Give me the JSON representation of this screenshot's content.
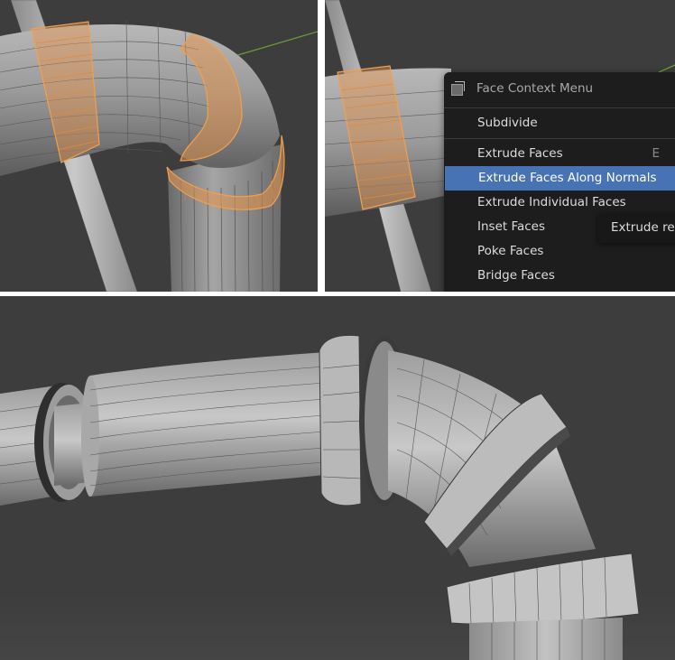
{
  "context_menu": {
    "title": "Face Context Menu",
    "icon": "face-select-icon",
    "items": [
      {
        "label": "Subdivide",
        "shortcut": ""
      },
      {
        "label": "Extrude Faces",
        "shortcut": "E"
      },
      {
        "label": "Extrude Faces Along Normals",
        "shortcut": "",
        "highlighted": true
      },
      {
        "label": "Extrude Individual Faces",
        "shortcut": ""
      },
      {
        "label": "Inset Faces",
        "shortcut": ""
      },
      {
        "label": "Poke Faces",
        "shortcut": ""
      },
      {
        "label": "Bridge Faces",
        "shortcut": ""
      }
    ]
  },
  "tooltip": {
    "text": "Extrude reg"
  },
  "colors": {
    "viewport_bg": "#3d3d3d",
    "selection_orange": "#e8944a",
    "menu_bg": "#1d1d1d",
    "menu_highlight": "#4772b3",
    "axis_green": "#6a9a3a"
  }
}
